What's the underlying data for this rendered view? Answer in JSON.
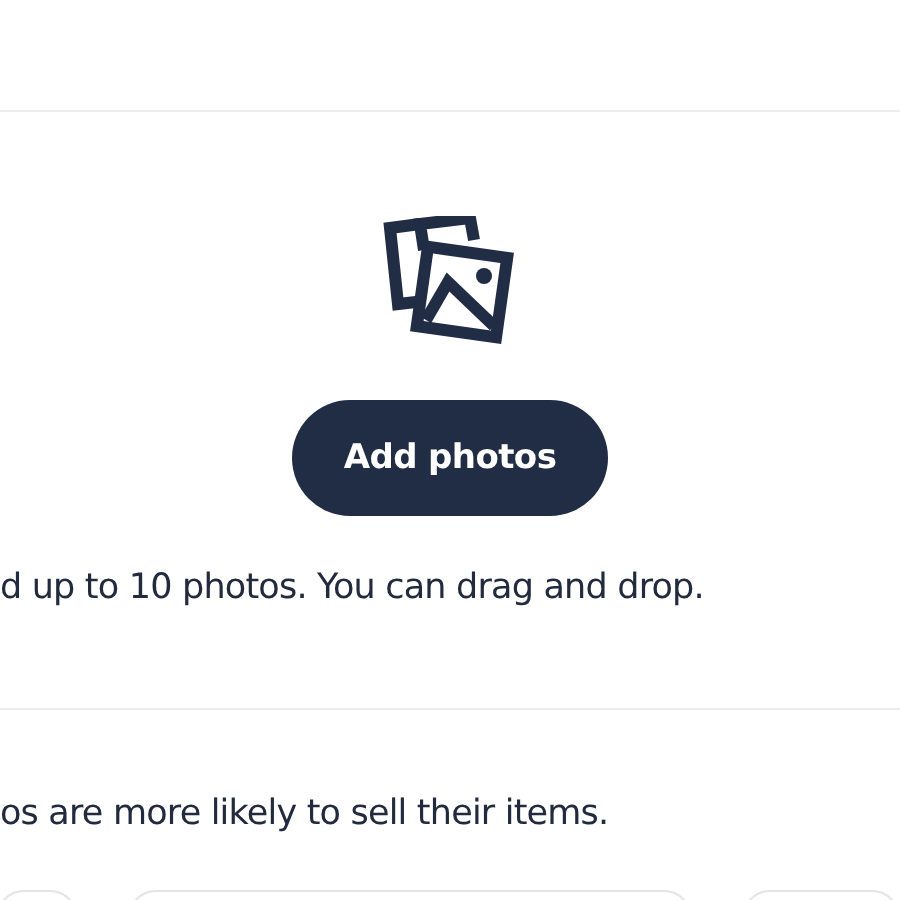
{
  "upload": {
    "button": "Add photos",
    "hint": "d up to 10 photos. You can drag and drop."
  },
  "tip": {
    "text": "os are more likely to sell their items."
  }
}
